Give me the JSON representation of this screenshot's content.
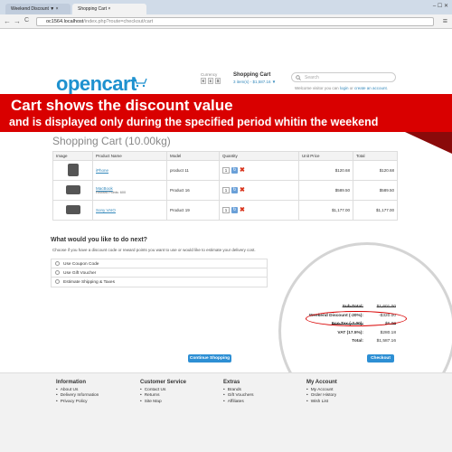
{
  "browser": {
    "tabs": [
      {
        "label": "Weekend Discount ▼ ×"
      },
      {
        "label": "Shopping Cart ×"
      }
    ],
    "window_buttons": "– ☐ ✕",
    "nav_back": "←",
    "nav_forward": "→",
    "nav_reload": "C",
    "url_host": "oc1564.localhost",
    "url_path": "/index.php?route=checkout/cart",
    "menu_glyph": "≡"
  },
  "store": {
    "logo_text": "opencart",
    "currency_label": "Currency",
    "currency_options": [
      "€",
      "£",
      "$"
    ],
    "header_cart_title": "Shopping Cart",
    "header_cart_summary": "3 item(s) - $1,587.16 ▼",
    "search_placeholder": "Search",
    "welcome_text": "Welcome visitor you can",
    "login_link": "login",
    "or_text": "or",
    "create_link": "create an account",
    "welcome_end": "."
  },
  "banner": {
    "line1": "Cart shows the discount value",
    "line2": "and is displayed only during the specified period whitin the weekend"
  },
  "page_title": "Shopping Cart  (10.00kg)",
  "cart_table": {
    "headers": [
      "Image",
      "Product Name",
      "Model",
      "Quantity",
      "Unit Price",
      "Total"
    ],
    "rows": [
      {
        "name": "iPhone",
        "note": "",
        "model": "product 11",
        "qty": "1",
        "unit": "$120.68",
        "total": "$120.68"
      },
      {
        "name": "MacBook",
        "note": "Reward Points: 600",
        "model": "Product 16",
        "qty": "1",
        "unit": "$589.50",
        "total": "$589.50"
      },
      {
        "name": "Sony VAIO",
        "note": "",
        "model": "Product 19",
        "qty": "1",
        "unit": "$1,177.00",
        "total": "$1,177.00"
      }
    ]
  },
  "next": {
    "heading": "What would you like to do next?",
    "description": "Choose if you have a discount code or reward points you want to use or would like to estimate your delivery cost.",
    "options": [
      "Use Coupon Code",
      "Use Gift Voucher",
      "Estimate Shipping & Taxes"
    ]
  },
  "totals": [
    {
      "label": "Sub-Total:",
      "value": "$1,601.00",
      "strike": true
    },
    {
      "label": "Weekend Discount (-20%):",
      "value": "-$320.00",
      "strike": false
    },
    {
      "label": "Eco Tax (-2.00):",
      "value": "$6.00",
      "strike": true
    },
    {
      "label": "VAT (17.5%):",
      "value": "$280.18",
      "strike": false
    },
    {
      "label": "Total:",
      "value": "$1,587.16",
      "strike": false
    }
  ],
  "buttons": {
    "continue": "Continue Shopping",
    "checkout": "Checkout"
  },
  "footer": {
    "columns": [
      {
        "heading": "Information",
        "items": [
          "About Us",
          "Delivery Information",
          "Privacy Policy"
        ]
      },
      {
        "heading": "Customer Service",
        "items": [
          "Contact Us",
          "Returns",
          "Site Map"
        ]
      },
      {
        "heading": "Extras",
        "items": [
          "Brands",
          "Gift Vouchers",
          "Affiliates"
        ]
      },
      {
        "heading": "My Account",
        "items": [
          "My Account",
          "Order History",
          "Wish List"
        ]
      }
    ]
  },
  "colors": {
    "banner_red": "#d90000",
    "brand_blue": "#1e91cf",
    "button_blue": "#2d8fd4",
    "remove_red": "#d9341c"
  }
}
